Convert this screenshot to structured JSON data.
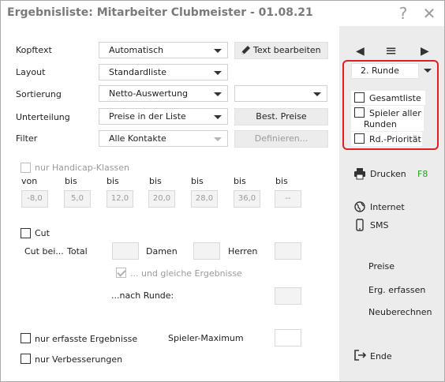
{
  "window": {
    "title": "Ergebnisliste: Mitarbeiter Clubmeister - 01.08.21",
    "help_label": "?",
    "close_label": "✕"
  },
  "form": {
    "kopftext": {
      "label": "Kopftext",
      "value": "Automatisch"
    },
    "text_bearbeiten": "Text bearbeiten",
    "layout": {
      "label": "Layout",
      "value": "Standardliste"
    },
    "sortierung": {
      "label": "Sortierung",
      "value": "Netto-Auswertung",
      "value2": ""
    },
    "unterteilung": {
      "label": "Unterteilung",
      "value": "Preise in der Liste"
    },
    "best_preise": "Best. Preise",
    "filter": {
      "label": "Filter",
      "value": "Alle Kontakte"
    },
    "definieren": "Definieren..."
  },
  "handicap": {
    "checkbox_label": "nur Handicap-Klassen",
    "headers": [
      "von",
      "bis",
      "bis",
      "bis",
      "bis",
      "bis",
      "bis"
    ],
    "values": [
      "-8,0",
      "5,0",
      "12,0",
      "20,0",
      "28,0",
      "36,0",
      "--"
    ]
  },
  "cut": {
    "checkbox_label": "Cut",
    "cut_bei": "Cut bei...",
    "total": "Total",
    "damen": "Damen",
    "herren": "Herren",
    "gleiche": "... und gleiche Ergebnisse",
    "nach_runde": "...nach Runde:"
  },
  "bottom": {
    "nur_erfasste": "nur erfasste Ergebnisse",
    "spieler_maximum": "Spieler-Maximum",
    "nur_verbesserungen": "nur Verbesserungen"
  },
  "right": {
    "nav_prev": "◀",
    "nav_menu": "≡",
    "nav_next": "▶",
    "runde": "2. Runde",
    "gesamtliste": "Gesamtliste",
    "spieler_aller_1": "Spieler aller",
    "spieler_aller_2": "Runden",
    "rd_prioritaet": "Rd.-Priorität",
    "drucken": "Drucken",
    "drucken_shortcut": "F8",
    "internet": "Internet",
    "sms": "SMS",
    "preise": "Preise",
    "erg_erfassen": "Erg. erfassen",
    "neuberechnen": "Neuberechnen",
    "ende": "Ende"
  },
  "colors": {
    "accent_red": "#e02020",
    "shortcut_green": "#2a9a2a",
    "panel_bg": "#ececec"
  }
}
